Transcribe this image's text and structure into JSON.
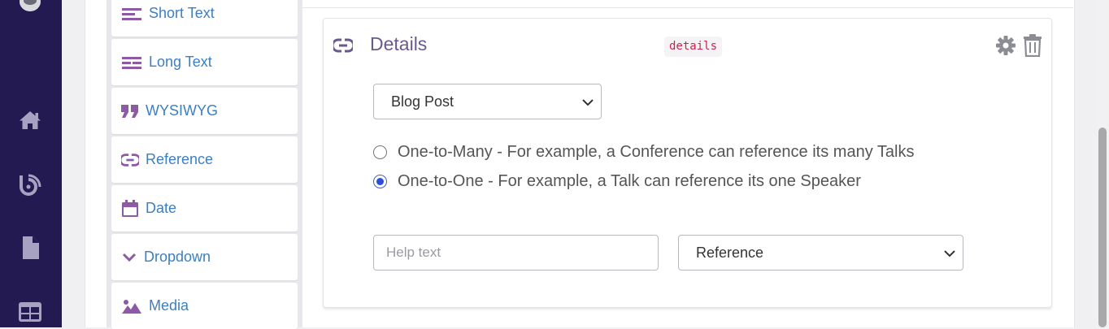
{
  "nav": {
    "items": [
      {
        "icon": "home-icon"
      },
      {
        "icon": "blog-icon"
      },
      {
        "icon": "document-icon"
      },
      {
        "icon": "grid-icon"
      }
    ]
  },
  "palette": {
    "items": [
      {
        "label": "Short Text",
        "icon": "short-text-icon"
      },
      {
        "label": "Long Text",
        "icon": "long-text-icon"
      },
      {
        "label": "WYSIWYG",
        "icon": "quote-icon"
      },
      {
        "label": "Reference",
        "icon": "link-icon"
      },
      {
        "label": "Date",
        "icon": "calendar-icon"
      },
      {
        "label": "Dropdown",
        "icon": "chevron-down-icon"
      },
      {
        "label": "Media",
        "icon": "image-icon"
      }
    ]
  },
  "field": {
    "title": "Details",
    "key": "details",
    "content_type": {
      "selected": "Blog Post"
    },
    "relation": {
      "options": [
        {
          "label": "One-to-Many - For example, a Conference can reference its many Talks",
          "checked": false
        },
        {
          "label": "One-to-One - For example, a Talk can reference its one Speaker",
          "checked": true
        }
      ]
    },
    "help": {
      "value": "",
      "placeholder": "Help text"
    },
    "field_type": {
      "selected": "Reference"
    }
  },
  "colors": {
    "nav_bg": "#241a52",
    "accent_purple": "#8e5aa6",
    "link_blue": "#3c7fc2",
    "radio_blue": "#2d4fd8",
    "key_red": "#c7254e"
  }
}
